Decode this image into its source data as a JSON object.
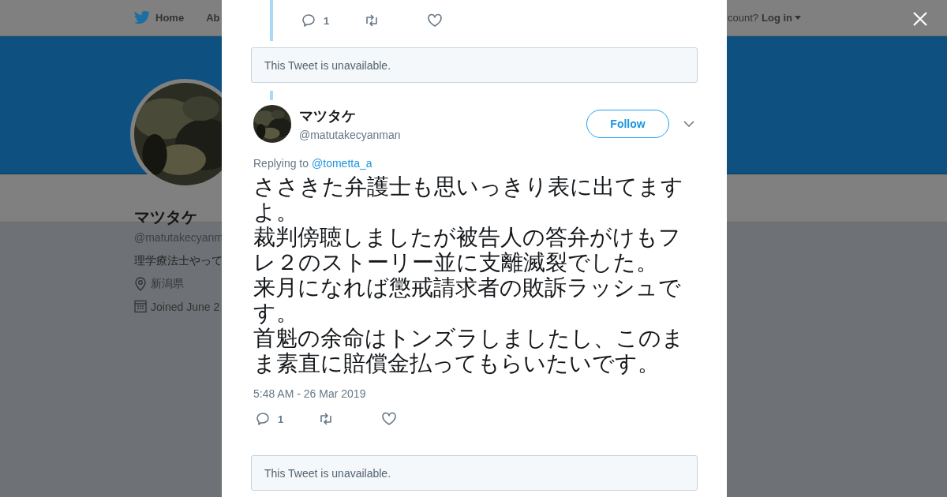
{
  "nav": {
    "home": "Home",
    "about": "Ab",
    "account_prompt": "count?",
    "login": "Log in"
  },
  "profile": {
    "name": "マツタケ",
    "handle": "@matutakecyanm",
    "bio": "理学療法士やって",
    "location": "新潟県",
    "joined": "Joined June 2"
  },
  "previous_tweet": {
    "replies": "1"
  },
  "notices": [
    "This Tweet is unavailable.",
    "This Tweet is unavailable."
  ],
  "tweet": {
    "name": "マツタケ",
    "handle": "@matutakecyanman",
    "follow": "Follow",
    "replying_prefix": "Replying to",
    "replying_to": "@tometta_a",
    "paragraphs": [
      "ささきた弁護士も思いっきり表に出てますよ。",
      "裁判傍聴しましたが被告人の答弁がけもフレ２のストーリー並に支離滅裂でした。",
      "来月になれば懲戒請求者の敗訴ラッシュです。",
      "首魁の余命はトンズラしましたし、このまま素直に賠償金払ってもらいたいです。"
    ],
    "time": "5:48 AM - 26 Mar 2019",
    "replies": "1"
  }
}
